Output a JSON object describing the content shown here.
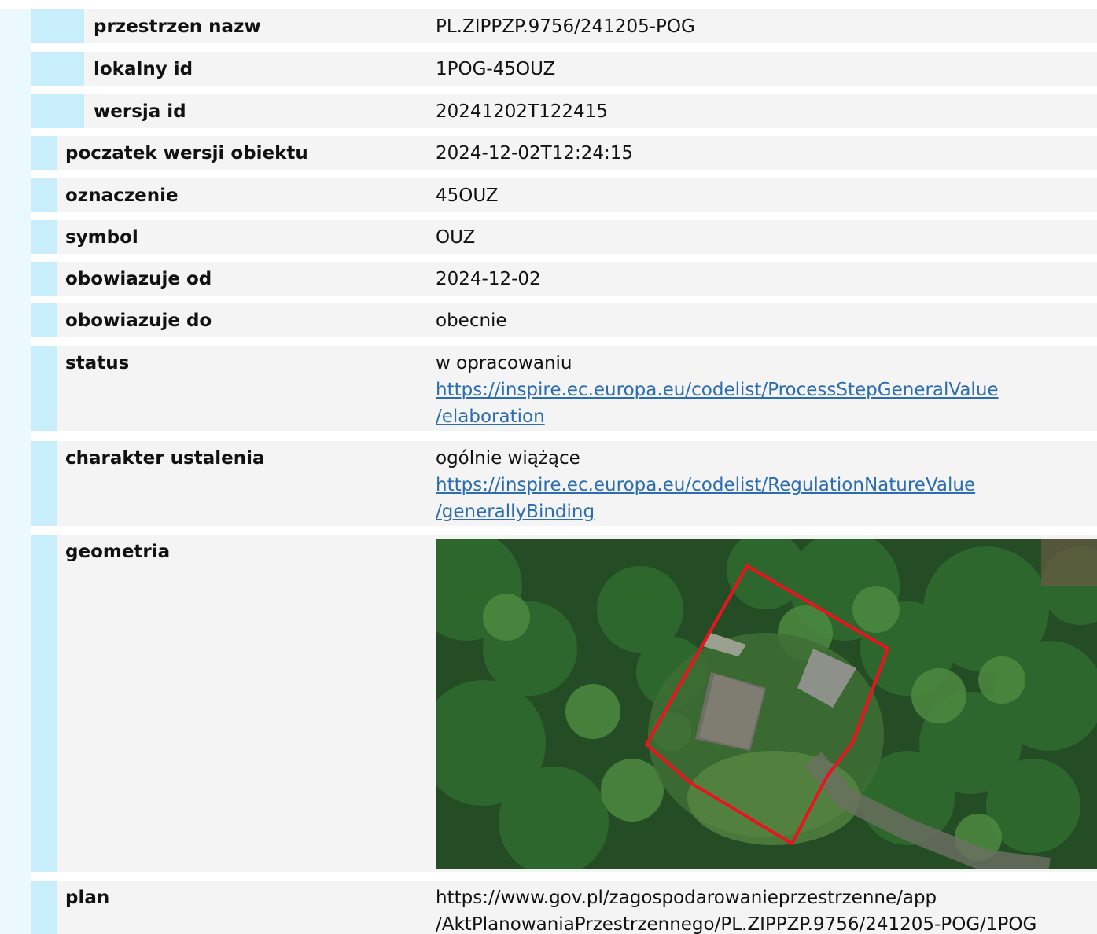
{
  "rows": {
    "przestrzen_nazw": {
      "label": "przestrzen nazw",
      "value": "PL.ZIPPZP.9756/241205-POG"
    },
    "lokalny_id": {
      "label": "lokalny id",
      "value": "1POG-45OUZ"
    },
    "wersja_id": {
      "label": "wersja id",
      "value": "20241202T122415"
    },
    "poczatek": {
      "label": "poczatek wersji obiektu",
      "value": "2024-12-02T12:24:15"
    },
    "oznaczenie": {
      "label": "oznaczenie",
      "value": "45OUZ"
    },
    "symbol": {
      "label": "symbol",
      "value": "OUZ"
    },
    "obowiazuje_od": {
      "label": "obowiazuje od",
      "value": "2024-12-02"
    },
    "obowiazuje_do": {
      "label": "obowiazuje do",
      "value": "obecnie"
    },
    "status": {
      "label": "status",
      "value": "w opracowaniu",
      "link_line1": "https://inspire.ec.europa.eu/codelist/ProcessStepGeneralValue",
      "link_line2": "/elaboration"
    },
    "charakter": {
      "label": "charakter ustalenia",
      "value": "ogólnie wiążące",
      "link_line1": "https://inspire.ec.europa.eu/codelist/RegulationNatureValue",
      "link_line2": "/generallyBinding"
    },
    "geometria": {
      "label": "geometria",
      "map": "aerial-photo-with-red-parcel-outline"
    },
    "plan": {
      "label": "plan",
      "value_line1": "https://www.gov.pl/zagospodarowanieprzestrzenne/app",
      "value_line2": "/AktPlanowaniaPrzestrzennego/PL.ZIPPZP.9756/241205-POG/1POG"
    }
  },
  "colors": {
    "row_bg": "#f4f4f4",
    "indent_bar": "#c8eefb",
    "outer_strip": "#ebf8fe",
    "link": "#2b6db0",
    "parcel_outline": "#e8141e"
  }
}
